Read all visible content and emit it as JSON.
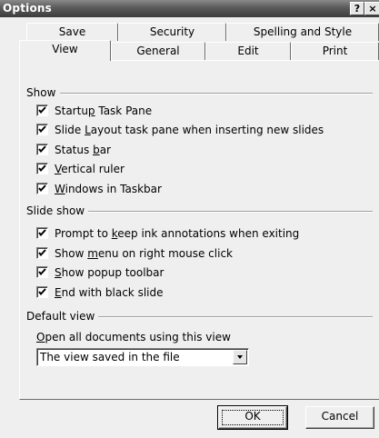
{
  "window": {
    "title": "Options",
    "help_label": "?",
    "close_label": "×"
  },
  "tabs_back": [
    {
      "label": "Save"
    },
    {
      "label": "Security"
    },
    {
      "label": "Spelling and Style"
    }
  ],
  "tabs_front": [
    {
      "label": "View",
      "active": true
    },
    {
      "label": "General"
    },
    {
      "label": "Edit"
    },
    {
      "label": "Print"
    }
  ],
  "groups": {
    "show": "Show",
    "slide_show": "Slide show",
    "default_view": "Default view"
  },
  "show_options": [
    {
      "pre": "Startu",
      "key": "p",
      "post": " Task Pane",
      "checked": true
    },
    {
      "pre": "Slide ",
      "key": "L",
      "post": "ayout task pane when inserting new slides",
      "checked": true
    },
    {
      "pre": "Status ",
      "key": "b",
      "post": "ar",
      "checked": true
    },
    {
      "pre": "",
      "key": "V",
      "post": "ertical ruler",
      "checked": true
    },
    {
      "pre": "",
      "key": "W",
      "post": "indows in Taskbar",
      "checked": true
    }
  ],
  "slideshow_options": [
    {
      "pre": "Prompt to ",
      "key": "k",
      "post": "eep ink annotations when exiting",
      "checked": true
    },
    {
      "pre": "Show ",
      "key": "m",
      "post": "enu on right mouse click",
      "checked": true
    },
    {
      "pre": "",
      "key": "S",
      "post": "how popup toolbar",
      "checked": true
    },
    {
      "pre": "",
      "key": "E",
      "post": "nd with black slide",
      "checked": true
    }
  ],
  "default_view": {
    "label_key": "O",
    "label_post": "pen all documents using this view",
    "selected": "The view saved in the file"
  },
  "buttons": {
    "ok": "OK",
    "cancel": "Cancel"
  }
}
